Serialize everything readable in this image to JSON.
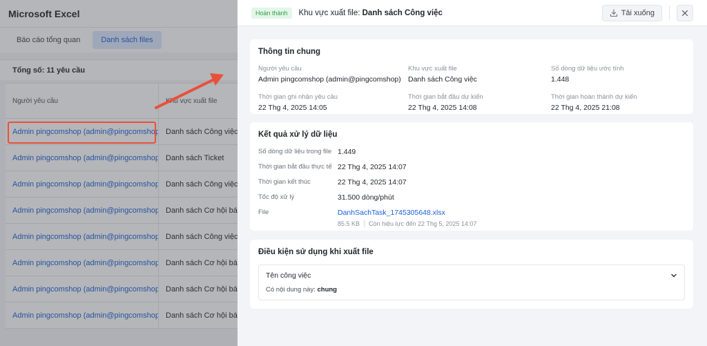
{
  "app": {
    "title": "Microsoft Excel",
    "tabs": [
      {
        "label": "Báo cáo tổng quan"
      },
      {
        "label": "Danh sách files"
      }
    ],
    "summary": "Tổng số: 11 yêu cầu",
    "table": {
      "columns": [
        "Người yêu cầu",
        "Khu vực xuất file"
      ],
      "rows": [
        {
          "requester": "Admin pingcomshop (admin@pingcomshop)",
          "area": "Danh sách Công việc"
        },
        {
          "requester": "Admin pingcomshop (admin@pingcomshop)",
          "area": "Danh sách Ticket"
        },
        {
          "requester": "Admin pingcomshop (admin@pingcomshop)",
          "area": "Danh sách Công việc"
        },
        {
          "requester": "Admin pingcomshop (admin@pingcomshop)",
          "area": "Danh sách Cơ hội bán"
        },
        {
          "requester": "Admin pingcomshop (admin@pingcomshop)",
          "area": "Danh sách Công việc"
        },
        {
          "requester": "Admin pingcomshop (admin@pingcomshop)",
          "area": "Danh sách Cơ hội bán"
        },
        {
          "requester": "Admin pingcomshop (admin@pingcomshop)",
          "area": "Danh sách Cơ hội bán"
        },
        {
          "requester": "Admin pingcomshop (admin@pingcomshop)",
          "area": "Danh sách Cơ hội bán"
        }
      ]
    }
  },
  "drawer": {
    "status": "Hoàn thành",
    "title_prefix": "Khu vực xuất file: ",
    "title_value": "Danh sách Công việc",
    "download_label": "Tải xuống",
    "general": {
      "title": "Thông tin chung",
      "fields": [
        {
          "label": "Người yêu cầu",
          "value": "Admin pingcomshop (admin@pingcomshop)"
        },
        {
          "label": "Khu vực xuất file",
          "value": "Danh sách Công việc"
        },
        {
          "label": "Số dòng dữ liệu ước tính",
          "value": "1.448"
        },
        {
          "label": "Thời gian ghi nhận yêu cầu",
          "value": "22 Thg 4, 2025 14:05"
        },
        {
          "label": "Thời gian bắt đầu dự kiến",
          "value": "22 Thg 4, 2025 14:08"
        },
        {
          "label": "Thời gian hoàn thành dự kiến",
          "value": "22 Thg 4, 2025 21:08"
        }
      ]
    },
    "result": {
      "title": "Kết quả xử lý dữ liệu",
      "rows": [
        {
          "label": "Số dòng dữ liệu trong file",
          "value": "1.449"
        },
        {
          "label": "Thời gian bắt đầu thực tế",
          "value": "22 Thg 4, 2025 14:07"
        },
        {
          "label": "Thời gian kết thúc",
          "value": "22 Thg 4, 2025 14:07"
        },
        {
          "label": "Tốc độ xử lý",
          "value": "31.500 dòng/phút"
        }
      ],
      "file_label": "File",
      "file_name": "DanhSachTask_1745305648.xlsx",
      "file_size": "85.5 KB",
      "file_expiry": "Còn hiệu lực đến 22 Thg 5, 2025 14:07"
    },
    "conditions": {
      "title": "Điều kiện sử dụng khi xuất file",
      "field_name": "Tên công việc",
      "rule_prefix": "Có nội dung này: ",
      "rule_value": "chung"
    }
  },
  "colors": {
    "accent": "#1a5fd6",
    "success": "#2e9e47",
    "highlight": "#e8503a"
  },
  "icons": [
    "download-icon",
    "close-icon",
    "chevron-down-icon",
    "arrow-annotation-icon"
  ]
}
